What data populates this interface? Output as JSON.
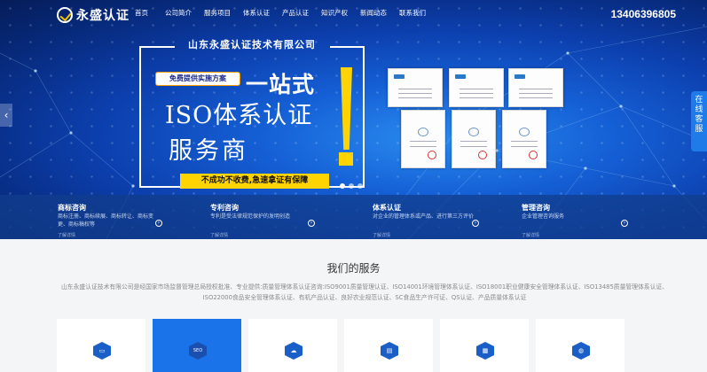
{
  "header": {
    "logo_text": "永盛认证",
    "nav": [
      "首页",
      "公司简介",
      "服务项目",
      "体系认证",
      "产品认证",
      "知识产权",
      "新闻动态",
      "联系我们"
    ],
    "phone": "13406396805"
  },
  "banner": {
    "company": "山东永盛认证技术有限公司",
    "free_tag": "免费提供实施方案",
    "headline_1": "一站式",
    "headline_2": "ISO体系认证",
    "headline_3": "服务商",
    "slogan": "不成功不收费,急速拿证有保障"
  },
  "float_service": [
    "在",
    "线",
    "客",
    "服"
  ],
  "strip": [
    {
      "title": "商标咨询",
      "desc": "商标注册、商标续展、商标转让、商标变更、商标稿权等",
      "more": "了解详情"
    },
    {
      "title": "专利咨询",
      "desc": "专利是受法律规范保护的发明创造",
      "more": "了解详情"
    },
    {
      "title": "体系认证",
      "desc": "对企业的管理体系或产品、进行第三方评价",
      "more": "了解详情"
    },
    {
      "title": "管理咨询",
      "desc": "企业管理咨询服务",
      "more": "了解详情"
    }
  ],
  "services": {
    "title": "我们的服务",
    "description": "山东永盛认证技术有限公司是经国家市场监督管理总局授权批准、专业提供:质量管理体系认证咨询:ISO9001质量管理认证、ISO14001环境管理体系认证、ISO18001职业健康安全管理体系认证、ISO13485质量管理体系认证、ISO22000食品安全管理体系认证、有机产品认证、良好农业规范认证、SC食品生产许可证、QS认证、产品质量体系认证"
  },
  "cards": [
    {
      "icon": "monitor-icon",
      "glyph": "▭"
    },
    {
      "icon": "seo-icon",
      "glyph": "SEO"
    },
    {
      "icon": "cloud-icon",
      "glyph": "☁"
    },
    {
      "icon": "book-icon",
      "glyph": "▤"
    },
    {
      "icon": "chart-icon",
      "glyph": "▦"
    },
    {
      "icon": "globe-icon",
      "glyph": "◍"
    }
  ]
}
